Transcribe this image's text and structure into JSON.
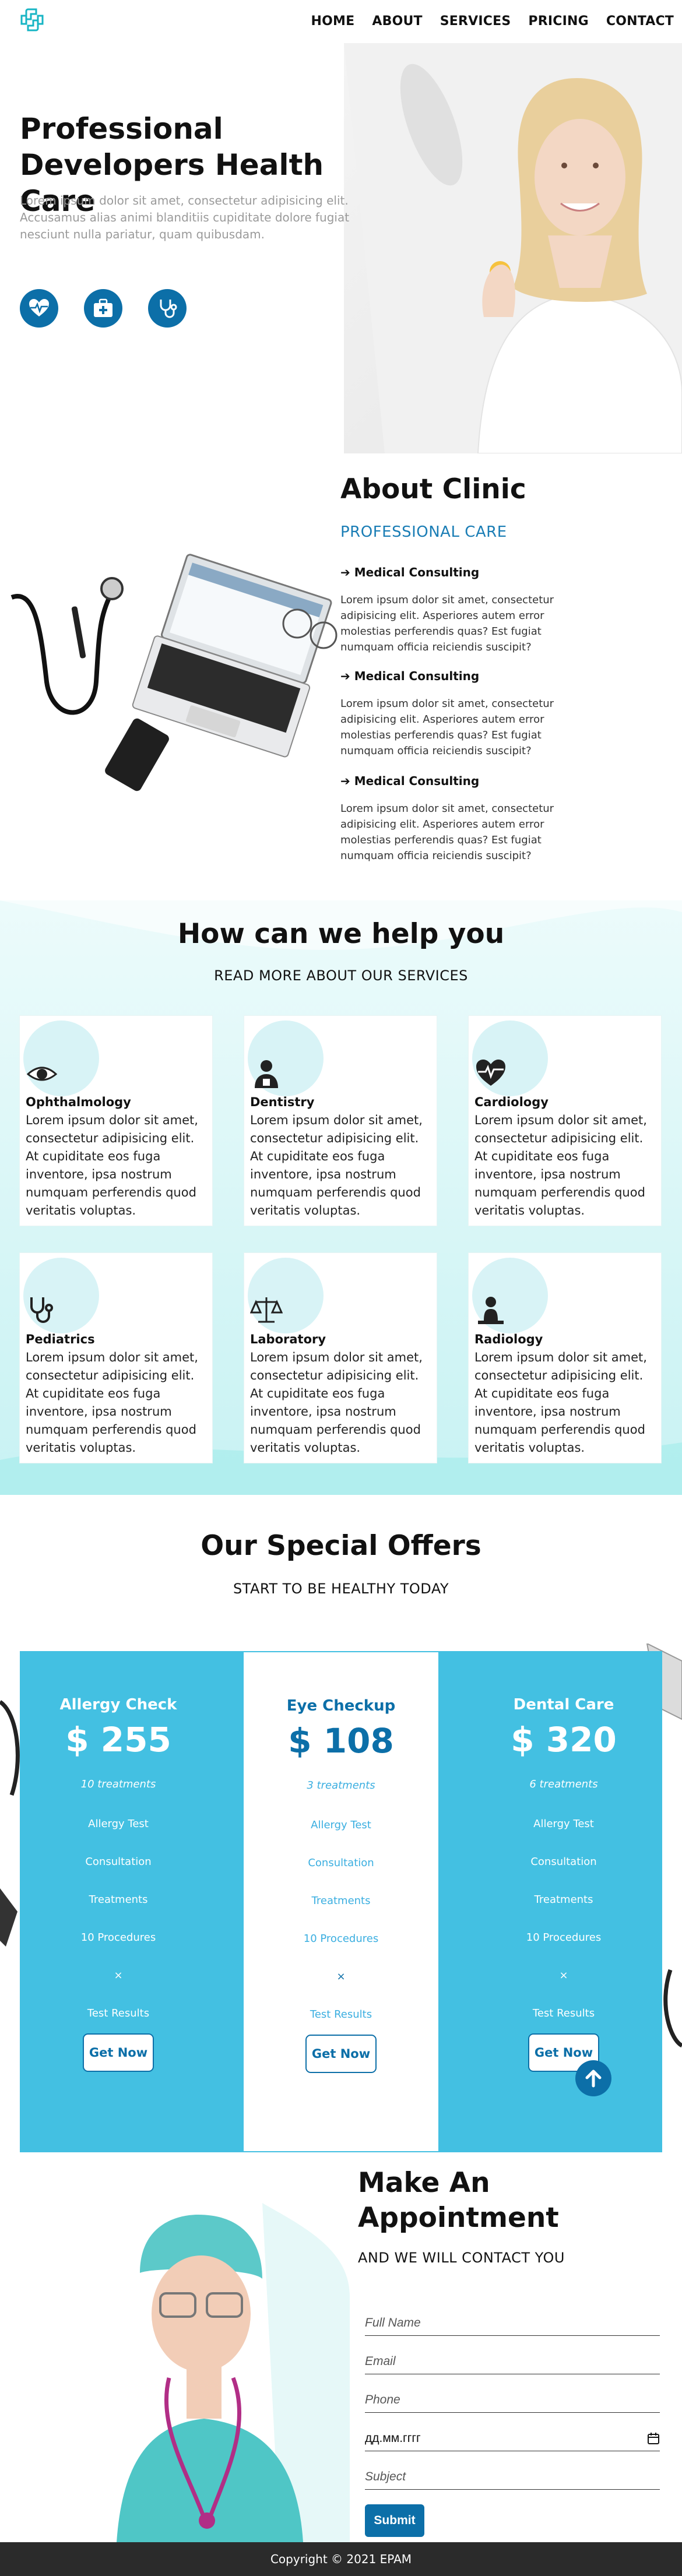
{
  "nav": {
    "items": [
      "HOME",
      "ABOUT",
      "SERVICES",
      "PRICING",
      "CONTACT"
    ]
  },
  "hero": {
    "title": "Professional Developers Health Care",
    "text_line1": "Lorem ipsum dolor sit amet, consectetur adipisicing elit.",
    "text_line2": "Accusamus alias animi blanditiis cupiditate dolore fugiat nesciunt nulla pariatur, quam quibusdam.",
    "icons": [
      "heart-pulse-icon",
      "medical-kit-icon",
      "stethoscope-icon"
    ]
  },
  "about": {
    "title": "About Clinic",
    "subtitle": "PROFESSIONAL CARE",
    "features": [
      {
        "title": "Medical Consulting",
        "text": "Lorem ipsum dolor sit amet, consectetur adipisicing elit. Asperiores autem error molestias perferendis quas? Est fugiat numquam officia reiciendis suscipit?"
      },
      {
        "title": "Medical Consulting",
        "text": "Lorem ipsum dolor sit amet, consectetur adipisicing elit. Asperiores autem error molestias perferendis quas? Est fugiat numquam officia reiciendis suscipit?"
      },
      {
        "title": "Medical Consulting",
        "text": "Lorem ipsum dolor sit amet, consectetur adipisicing elit. Asperiores autem error molestias perferendis quas? Est fugiat numquam officia reiciendis suscipit?"
      }
    ]
  },
  "services": {
    "title": "How can we help you",
    "subtitle": "READ MORE ABOUT OUR SERVICES",
    "cards": [
      {
        "title": "Ophthalmology",
        "icon": "eye-icon",
        "text": "Lorem ipsum dolor sit amet, consectetur adipisicing elit. At cupiditate eos fuga inventore, ipsa nostrum numquam perferendis quod veritatis voluptas."
      },
      {
        "title": "Dentistry",
        "icon": "dentist-icon",
        "text": "Lorem ipsum dolor sit amet, consectetur adipisicing elit. At cupiditate eos fuga inventore, ipsa nostrum numquam perferendis quod veritatis voluptas."
      },
      {
        "title": "Cardiology",
        "icon": "heart-pulse-icon",
        "text": "Lorem ipsum dolor sit amet, consectetur adipisicing elit. At cupiditate eos fuga inventore, ipsa nostrum numquam perferendis quod veritatis voluptas."
      },
      {
        "title": "Pediatrics",
        "icon": "stethoscope-icon",
        "text": "Lorem ipsum dolor sit amet, consectetur adipisicing elit. At cupiditate eos fuga inventore, ipsa nostrum numquam perferendis quod veritatis voluptas."
      },
      {
        "title": "Laboratory",
        "icon": "scales-icon",
        "text": "Lorem ipsum dolor sit amet, consectetur adipisicing elit. At cupiditate eos fuga inventore, ipsa nostrum numquam perferendis quod veritatis voluptas."
      },
      {
        "title": "Radiology",
        "icon": "person-scan-icon",
        "text": "Lorem ipsum dolor sit amet, consectetur adipisicing elit. At cupiditate eos fuga inventore, ipsa nostrum numquam perferendis quod veritatis voluptas."
      }
    ]
  },
  "offers": {
    "title": "Our Special Offers",
    "subtitle": "START TO BE HEALTHY TODAY",
    "plans": [
      {
        "name": "Allergy Check",
        "price": "$ 255",
        "treatments": "10 treatments",
        "features": [
          "Allergy Test",
          "Consultation",
          "Treatments",
          "10 Procedures",
          "×",
          "Test Results"
        ],
        "button": "Get Now"
      },
      {
        "name": "Eye Checkup",
        "price": "$ 108",
        "treatments": "3 treatments",
        "features": [
          "Allergy Test",
          "Consultation",
          "Treatments",
          "10 Procedures",
          "×",
          "Test Results"
        ],
        "button": "Get Now"
      },
      {
        "name": "Dental Care",
        "price": "$ 320",
        "treatments": "6 treatments",
        "features": [
          "Allergy Test",
          "Consultation",
          "Treatments",
          "10 Procedures",
          "×",
          "Test Results"
        ],
        "button": "Get Now"
      }
    ]
  },
  "appointment": {
    "title": "Make An Appointment",
    "subtitle": "AND WE WILL CONTACT YOU",
    "fields": {
      "name": "Full Name",
      "email": "Email",
      "phone": "Phone",
      "date": "дд.мм.гггг",
      "subject": "Subject"
    },
    "submit": "Submit"
  },
  "footer": {
    "text": "Copyright © 2021 EPAM"
  },
  "colors": {
    "primary": "#0c6fa8",
    "accent": "#43c0e2",
    "accent_light": "#c8f2f3",
    "footer": "#2b2b2b"
  }
}
